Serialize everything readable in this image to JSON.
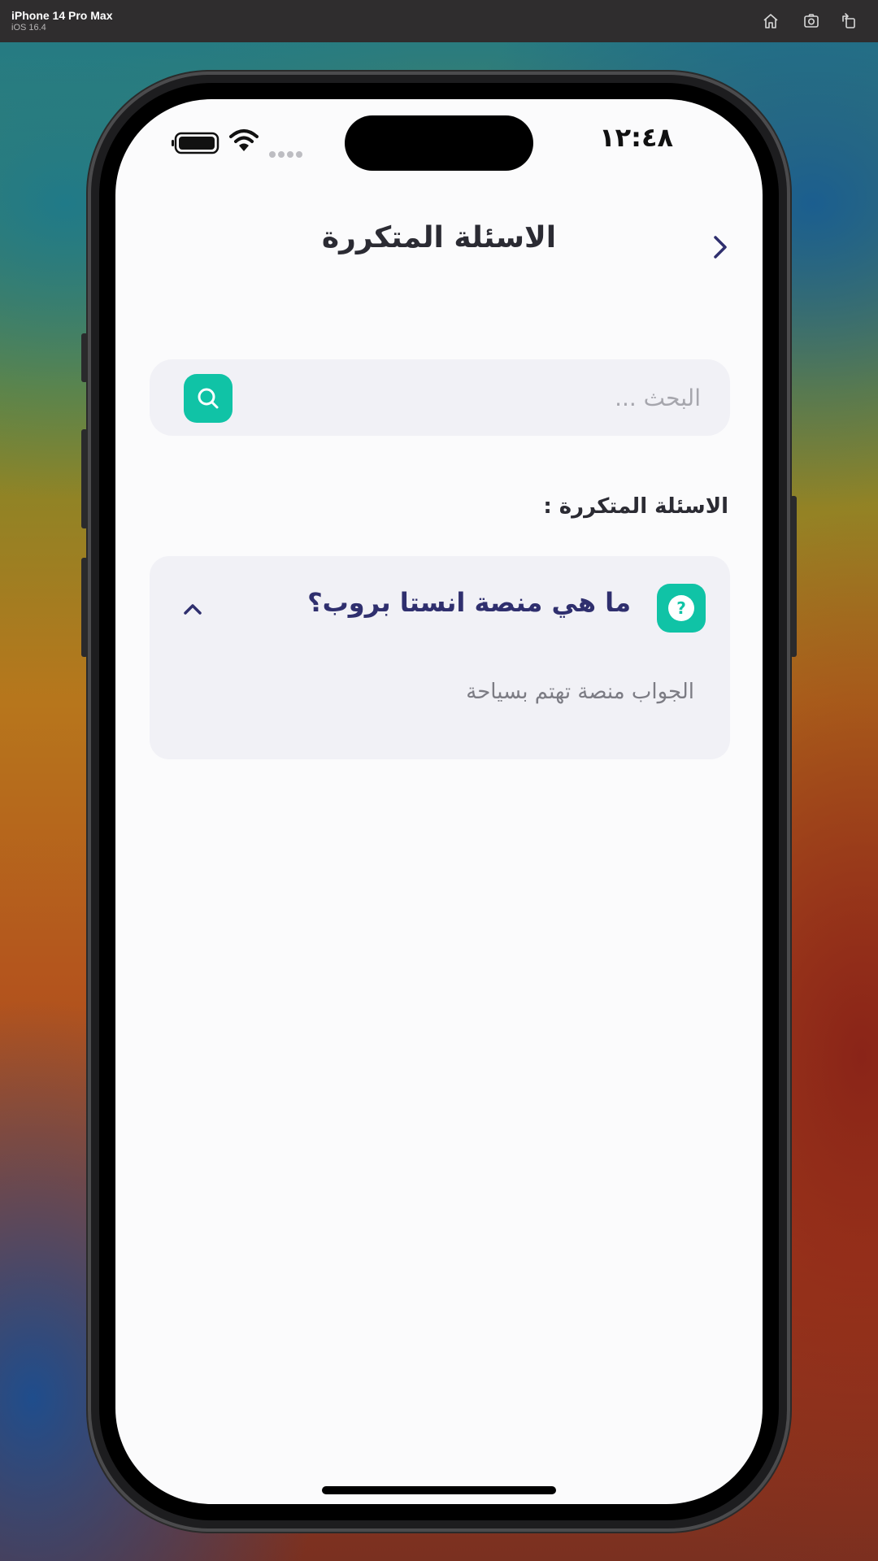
{
  "simulator": {
    "device_name": "iPhone 14 Pro Max",
    "os_version": "iOS 16.4",
    "toolbar_icons": [
      "home-icon",
      "screenshot-icon",
      "rotate-icon"
    ]
  },
  "status_bar": {
    "time": "١٢:٤٨",
    "icons": [
      "battery-icon",
      "wifi-icon",
      "signal-dots-icon"
    ]
  },
  "header": {
    "title": "الاسئلة المتكررة",
    "back_icon": "chevron-right-icon"
  },
  "search": {
    "placeholder": "البحث ...",
    "value": "",
    "button_icon": "search-icon"
  },
  "faq_section": {
    "heading": "الاسئلة المتكررة :",
    "items": [
      {
        "question": "ما هي منصة انستا بروب؟",
        "answer": "الجواب منصة تهتم بسياحة",
        "expanded": true,
        "icon": "question-icon",
        "toggle_icon": "chevron-up-icon"
      }
    ]
  },
  "colors": {
    "accent": "#10c3a6",
    "question_text": "#2f2f6e",
    "card_background": "#f1f1f6",
    "screen_background": "#fbfbfc"
  }
}
